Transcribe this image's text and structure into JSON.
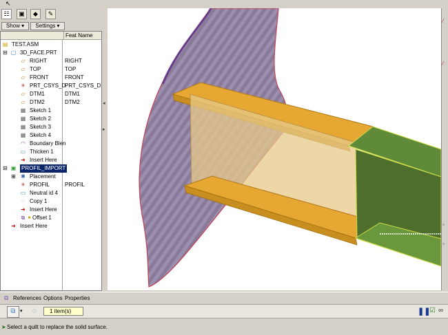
{
  "tabs": {
    "icons": [
      "model-tree-icon",
      "folder-browser-icon",
      "favorites-icon",
      "connections-icon"
    ]
  },
  "toolbar": {
    "show_label": "Show ▾",
    "settings_label": "Settings ▾"
  },
  "tree": {
    "column_header": "Feat Name",
    "items": [
      {
        "label": "TEST.ASM",
        "feat": ""
      },
      {
        "label": "3D_FACE.PRT",
        "feat": ""
      },
      {
        "label": "RIGHT",
        "feat": "RIGHT"
      },
      {
        "label": "TOP",
        "feat": "TOP"
      },
      {
        "label": "FRONT",
        "feat": "FRONT"
      },
      {
        "label": "PRT_CSYS_D",
        "feat": "PRT_CSYS_DEF"
      },
      {
        "label": "DTM1",
        "feat": "DTM1"
      },
      {
        "label": "DTM2",
        "feat": "DTM2"
      },
      {
        "label": "Sketch 1",
        "feat": ""
      },
      {
        "label": "Sketch 2",
        "feat": ""
      },
      {
        "label": "Sketch 3",
        "feat": ""
      },
      {
        "label": "Sketch 4",
        "feat": ""
      },
      {
        "label": "Boundary Blen",
        "feat": ""
      },
      {
        "label": "Thicken 1",
        "feat": ""
      },
      {
        "label": "Insert Here",
        "feat": ""
      },
      {
        "label": "PROFIL_IMPORT",
        "feat": ""
      },
      {
        "label": "Placement",
        "feat": ""
      },
      {
        "label": "PROFIL",
        "feat": "PROFIL"
      },
      {
        "label": "Neutral id 4",
        "feat": ""
      },
      {
        "label": "Copy 1",
        "feat": ""
      },
      {
        "label": "Insert Here",
        "feat": ""
      },
      {
        "label": "Offset 1",
        "feat": ""
      },
      {
        "label": "Insert Here",
        "feat": ""
      }
    ]
  },
  "dashboard": {
    "tabs": [
      "References",
      "Options",
      "Properties"
    ],
    "collector_value": "1 item(s)"
  },
  "status": {
    "message": "Select a quilt to replace the solid surface."
  }
}
